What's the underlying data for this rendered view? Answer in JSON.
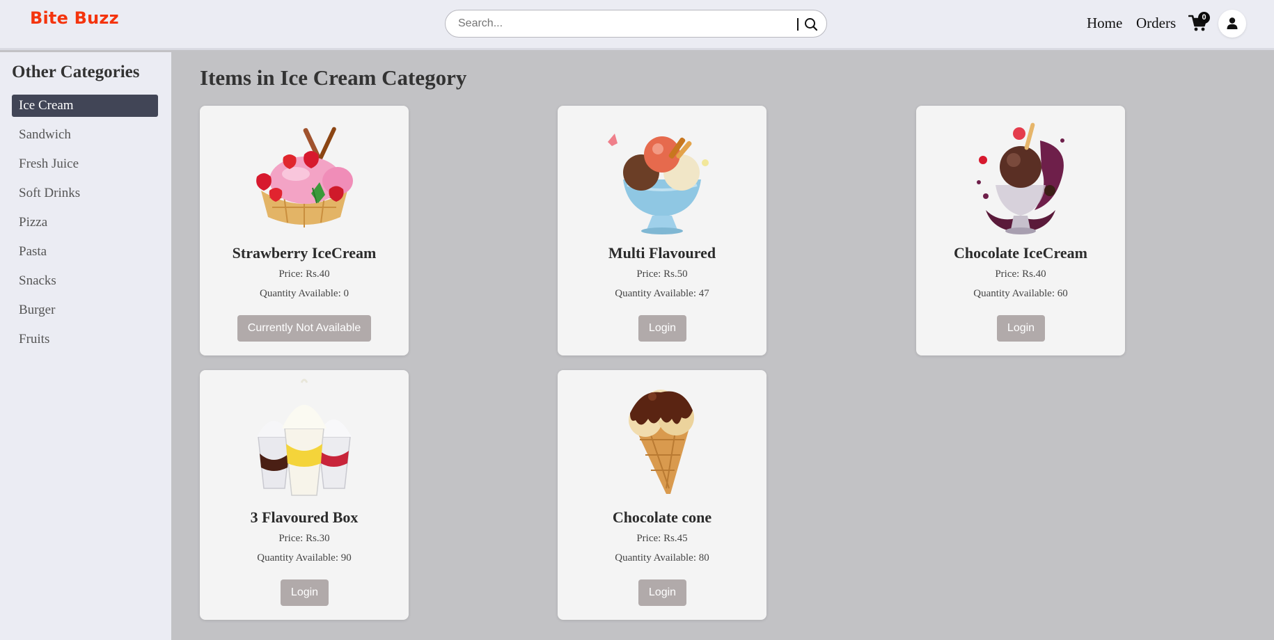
{
  "header": {
    "logo": "Bite Buzz",
    "search_placeholder": "Search...",
    "nav": {
      "home": "Home",
      "orders": "Orders"
    },
    "cart_count": "0",
    "icons": {
      "search": "search-icon",
      "cart": "cart-icon",
      "profile": "user-icon"
    }
  },
  "sidebar": {
    "title": "Other Categories",
    "items": [
      {
        "label": "Ice Cream"
      },
      {
        "label": "Sandwich"
      },
      {
        "label": "Fresh Juice"
      },
      {
        "label": "Soft Drinks"
      },
      {
        "label": "Pizza"
      },
      {
        "label": "Pasta"
      },
      {
        "label": "Snacks"
      },
      {
        "label": "Burger"
      },
      {
        "label": "Fruits"
      }
    ]
  },
  "main": {
    "title": "Items in Ice Cream Category",
    "items": [
      {
        "name": "Strawberry IceCream",
        "price": "Price: Rs.40",
        "qty": "Quantity Available: 0",
        "button": "Currently Not Available"
      },
      {
        "name": "Multi Flavoured",
        "price": "Price: Rs.50",
        "qty": "Quantity Available: 47",
        "button": "Login"
      },
      {
        "name": "Chocolate IceCream",
        "price": "Price: Rs.40",
        "qty": "Quantity Available: 60",
        "button": "Login"
      },
      {
        "name": "3 Flavoured Box",
        "price": "Price: Rs.30",
        "qty": "Quantity Available: 90",
        "button": "Login"
      },
      {
        "name": "Chocolate cone",
        "price": "Price: Rs.45",
        "qty": "Quantity Available: 80",
        "button": "Login"
      }
    ]
  },
  "colors": {
    "brand": "#f4340d",
    "sidebar_active": "#414556",
    "button": "#b1aaaa",
    "content_bg": "#c2c2c5"
  }
}
